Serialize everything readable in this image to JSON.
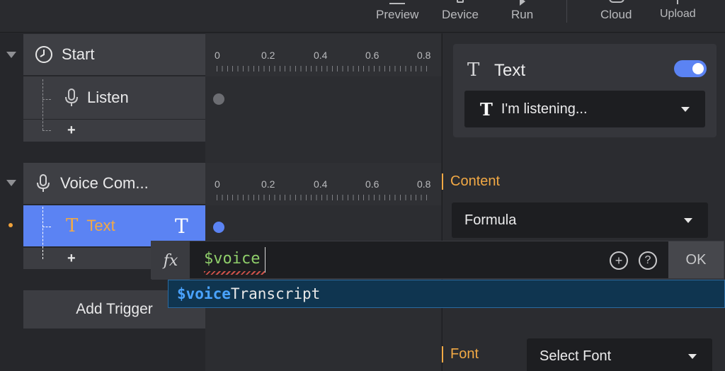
{
  "toolbar": {
    "preview": "Preview",
    "device": "Device",
    "run": "Run",
    "cloud": "Cloud",
    "upload": "Upload"
  },
  "tree": {
    "start": "Start",
    "listen": "Listen",
    "add_symbol": "+",
    "voice_command": "Voice Com...",
    "text": "Text",
    "add_trigger": "Add Trigger"
  },
  "ruler": {
    "labels": [
      "0",
      "0.2",
      "0.4",
      "0.6",
      "0.8"
    ]
  },
  "panel": {
    "text_title": "Text",
    "text_value": "I'm listening...",
    "content_label": "Content",
    "content_mode": "Formula",
    "font_label": "Font",
    "font_placeholder": "Select Font"
  },
  "formula": {
    "fx_label": "fx",
    "input_value": "$voice",
    "ok_label": "OK",
    "suggestion_match": "$voice",
    "suggestion_rest": "Transcript"
  },
  "colors": {
    "accent_blue": "#5b83f3",
    "accent_orange": "#f2a945",
    "suggestion_bg": "#0f3550"
  }
}
